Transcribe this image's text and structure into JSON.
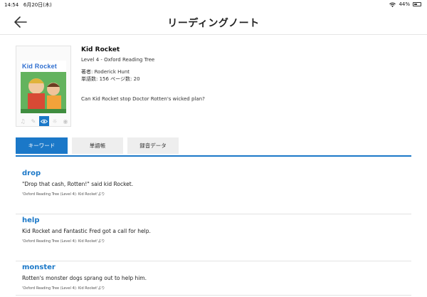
{
  "status": {
    "time": "14:54",
    "date": "6月20日(木)",
    "battery": "44%",
    "battery_level": 0.44
  },
  "header": {
    "title": "リーディングノート"
  },
  "book": {
    "cover_title": "Kid Rocket",
    "title": "Kid Rocket",
    "level": "Level 4 - Oxford Reading Tree",
    "author": "著者: Roderick Hunt",
    "stats": "単語数: 156   ページ数: 20",
    "description": "Can Kid Rocket stop Doctor Rotten's wicked plan?"
  },
  "tabs": [
    {
      "label": "キーワード",
      "active": true
    },
    {
      "label": "単語帳",
      "active": false
    },
    {
      "label": "録音データ",
      "active": false
    }
  ],
  "entries": [
    {
      "word": "drop",
      "sentence": "\"Drop that cash, Rotten!\" said kid Rocket.",
      "source": "'Oxford Reading Tree (Level 4): Kid Rocket'より"
    },
    {
      "word": "help",
      "sentence": "Kid Rocket and Fantastic Fred got a call for help.",
      "source": "'Oxford Reading Tree (Level 4): Kid Rocket'より"
    },
    {
      "word": "monster",
      "sentence": "Rotten's monster dogs sprang out to help him.",
      "source": "'Oxford Reading Tree (Level 4): Kid Rocket'より"
    }
  ]
}
